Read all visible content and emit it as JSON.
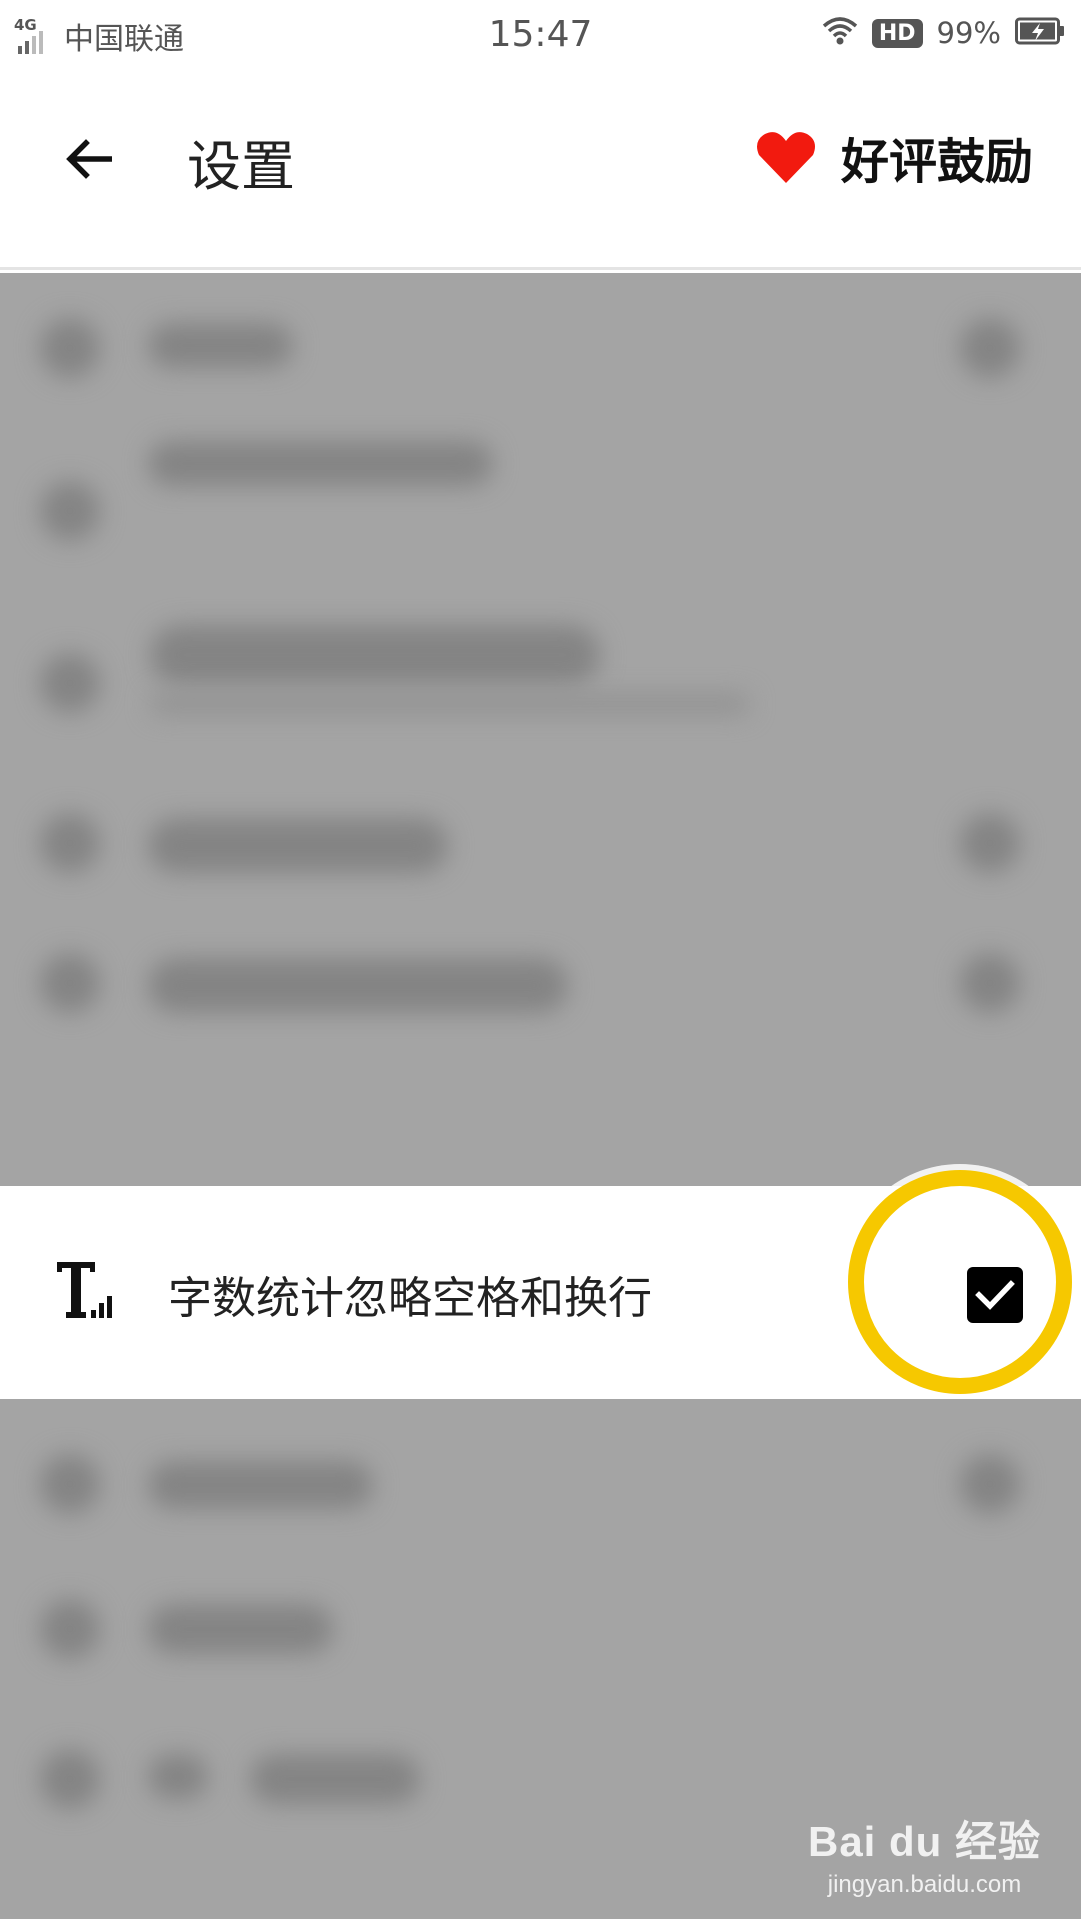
{
  "status_bar": {
    "network_type": "4G",
    "carrier": "中国联通",
    "time": "15:47",
    "hd_badge": "HD",
    "battery_percent": "99%"
  },
  "app_bar": {
    "title": "设置",
    "rate_label": "好评鼓励",
    "back_icon": "arrow-left-icon",
    "rate_icon": "heart-icon"
  },
  "highlighted_row": {
    "label": "字数统计忽略空格和换行",
    "icon": "text-count-icon",
    "checked": true
  },
  "highlight_color": "#f6c800",
  "watermark": {
    "logo": "Bai du 经验",
    "url": "jingyan.baidu.com"
  }
}
